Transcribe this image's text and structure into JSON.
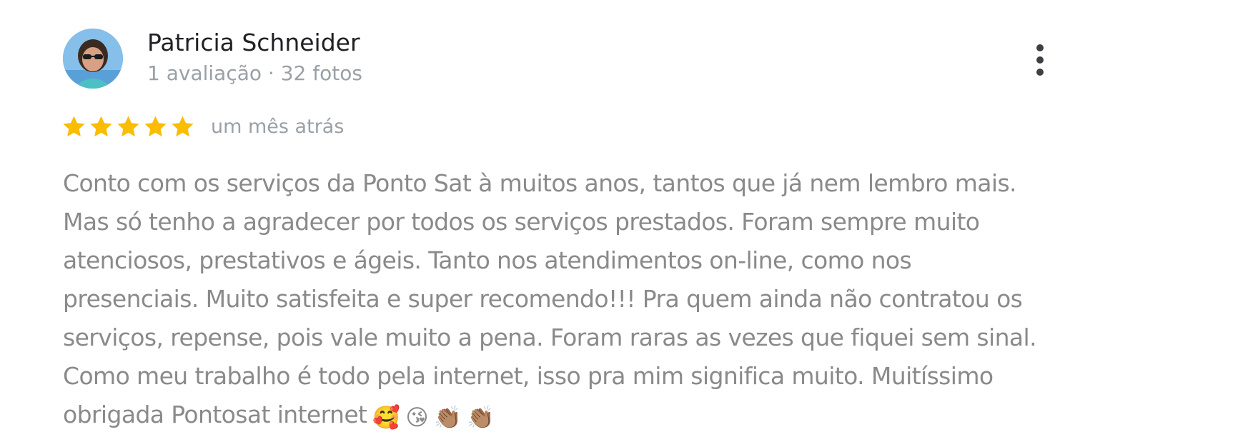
{
  "reviewer": {
    "name": "Patricia Schneider",
    "meta": "1 avaliação · 32 fotos",
    "avatar_icon": "user-photo"
  },
  "menu": {
    "icon": "more-vertical-icon"
  },
  "review": {
    "rating": 5,
    "max_rating": 5,
    "star_color": "#fbbc04",
    "date": "um mês atrás",
    "lines": [
      "Conto com os serviços da Ponto Sat à muitos anos, tantos que já nem lembro mais.",
      "Mas só tenho a agradecer por todos os serviços prestados. Foram sempre muito",
      "atenciosos, prestativos e ágeis. Tanto nos atendimentos on-line, como nos",
      "presenciais. Muito satisfeita e super recomendo!!! Pra quem ainda não contratou os",
      "serviços, repense, pois vale muito a pena. Foram raras as vezes que fiquei sem sinal.",
      "Como meu trabalho é todo pela internet, isso pra mim significa muito. Muitíssimo",
      "obrigada Pontosat internet"
    ],
    "emojis": [
      "🥰",
      "😘",
      "👏🏽",
      "👏🏽"
    ]
  }
}
